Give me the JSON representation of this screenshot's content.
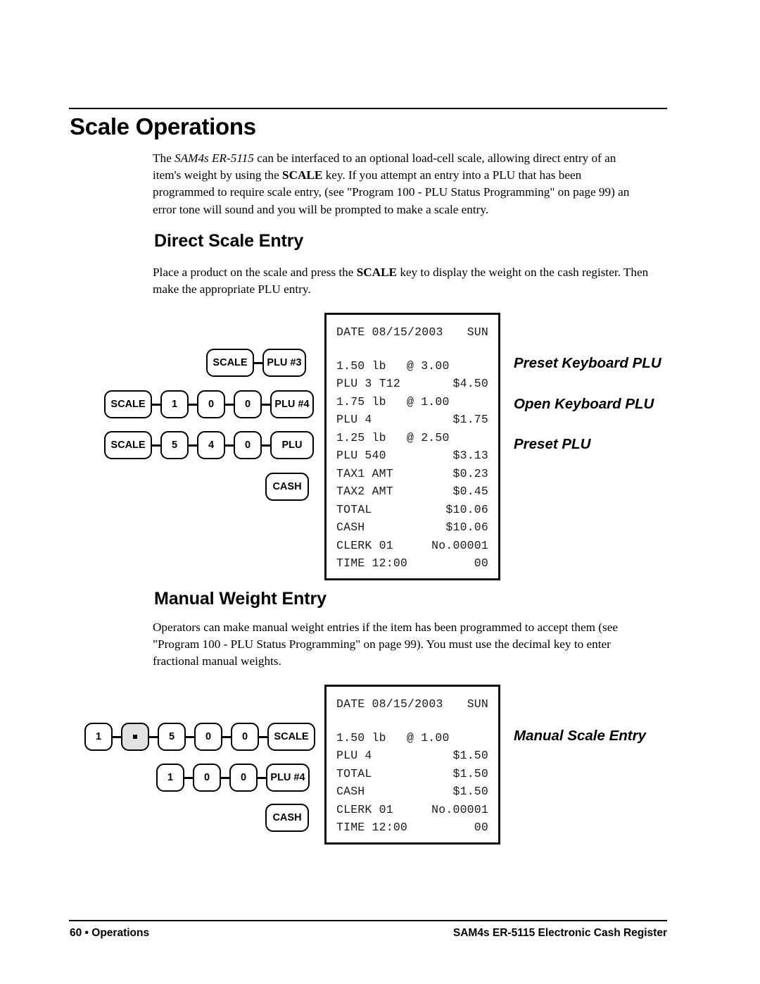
{
  "document": {
    "page_title": "Scale Operations",
    "intro_paragraph": {
      "seg1": "The ",
      "product_italic": "SAM4s ER-5115",
      "seg2": " can be interfaced to an optional load-cell scale, allowing direct entry of an item's weight by using the ",
      "scale_bold": "SCALE",
      "seg3": " key.  If you attempt an entry into a PLU that has been programmed to require scale entry, (see \"Program 100 - PLU Status Programming\" on page 99) an error tone will sound and you will be prompted to make a scale entry."
    }
  },
  "direct_scale_entry": {
    "heading": "Direct Scale Entry",
    "paragraph": {
      "seg1": "Place a product on the scale and press the ",
      "scale_bold": "SCALE",
      "seg2": " key to display the weight on the cash register. Then make the appropriate PLU entry."
    },
    "key_sequences": [
      {
        "name": "preset-keyboard-plu",
        "keys": [
          "SCALE",
          "PLU #3"
        ]
      },
      {
        "name": "open-keyboard-plu",
        "keys": [
          "SCALE",
          "1",
          "0",
          "0",
          "PLU #4"
        ]
      },
      {
        "name": "preset-plu",
        "keys": [
          "SCALE",
          "5",
          "4",
          "0",
          "PLU"
        ]
      },
      {
        "name": "tender",
        "keys": [
          "CASH"
        ]
      }
    ],
    "keys": {
      "scale": "SCALE",
      "plu3": "PLU #3",
      "plu4": "PLU #4",
      "plu": "PLU",
      "cash": "CASH",
      "n0": "0",
      "n1": "1",
      "n4": "4",
      "n5": "5"
    },
    "callouts": [
      "Preset Keyboard PLU",
      "Open Keyboard PLU",
      "Preset PLU"
    ],
    "receipt": {
      "header_date_label": "DATE",
      "header_date": "08/15/2003",
      "header_day": "SUN",
      "lines": [
        {
          "left": "1.50 lb",
          "right": "@ 3.00",
          "align": "col"
        },
        {
          "left": "PLU 3 T12",
          "right": "$4.50",
          "align": "right"
        },
        {
          "left": "1.75 lb",
          "right": "@ 1.00",
          "align": "col"
        },
        {
          "left": "PLU 4",
          "right": "$1.75",
          "align": "right"
        },
        {
          "left": "1.25 lb",
          "right": "@ 2.50",
          "align": "col"
        },
        {
          "left": "PLU 540",
          "right": "$3.13",
          "align": "right"
        },
        {
          "left": "TAX1 AMT",
          "right": "$0.23",
          "align": "right"
        },
        {
          "left": "TAX2 AMT",
          "right": "$0.45",
          "align": "right"
        },
        {
          "left": "TOTAL",
          "right": "$10.06",
          "align": "right"
        },
        {
          "left": "CASH",
          "right": "$10.06",
          "align": "right"
        },
        {
          "left": "CLERK 01",
          "right": "No.00001",
          "align": "right"
        },
        {
          "left": "TIME 12:00",
          "right": "00",
          "align": "right"
        }
      ]
    }
  },
  "manual_weight_entry": {
    "heading": "Manual Weight Entry",
    "paragraph": "Operators can make manual weight entries if the item has been programmed to accept them (see \"Program 100 - PLU Status Programming\" on page 99).  You must use the decimal key to enter fractional manual weights.",
    "key_sequences": [
      {
        "name": "manual-weight",
        "keys": [
          "1",
          ".",
          "5",
          "0",
          "0",
          "SCALE"
        ]
      },
      {
        "name": "plu-entry",
        "keys": [
          "1",
          "0",
          "0",
          "PLU #4"
        ]
      },
      {
        "name": "tender",
        "keys": [
          "CASH"
        ]
      }
    ],
    "keys": {
      "scale": "SCALE",
      "plu4": "PLU #4",
      "cash": "CASH",
      "decimal": ".",
      "n0": "0",
      "n1": "1",
      "n5": "5"
    },
    "callouts": [
      "Manual Scale Entry"
    ],
    "receipt": {
      "header_date_label": "DATE",
      "header_date": "08/15/2003",
      "header_day": "SUN",
      "lines": [
        {
          "left": "1.50 lb",
          "right": "@ 1.00",
          "align": "col"
        },
        {
          "left": "PLU 4",
          "right": "$1.50",
          "align": "right"
        },
        {
          "left": "TOTAL",
          "right": "$1.50",
          "align": "right"
        },
        {
          "left": "CASH",
          "right": "$1.50",
          "align": "right"
        },
        {
          "left": "CLERK 01",
          "right": "No.00001",
          "align": "right"
        },
        {
          "left": "TIME 12:00",
          "right": "00",
          "align": "right"
        }
      ]
    }
  },
  "footer": {
    "left": "60 • Operations",
    "right": "SAM4s ER-5115 Electronic Cash Register"
  },
  "colors": {
    "ink": "#000000",
    "receipt_text": "#1a1a1a",
    "shaded_key": "#e2e2e2"
  }
}
